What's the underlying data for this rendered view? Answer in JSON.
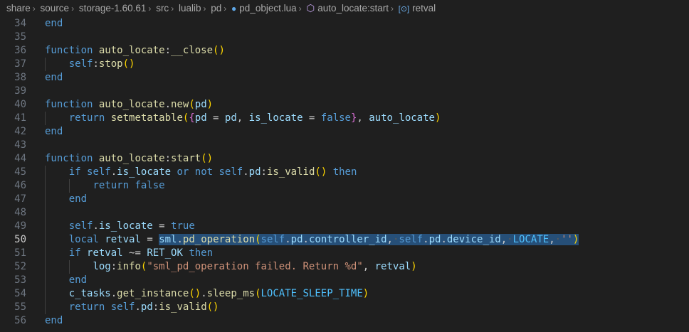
{
  "breadcrumb": {
    "items": [
      "share",
      "source",
      "storage-1.60.61",
      "src",
      "lualib",
      "pd"
    ],
    "file": "pd_object.lua",
    "symbol": "auto_locate:start",
    "variable": "retval"
  },
  "editor": {
    "current_line": 50,
    "line_numbers": [
      "34",
      "35",
      "36",
      "37",
      "38",
      "39",
      "40",
      "41",
      "42",
      "43",
      "44",
      "45",
      "46",
      "47",
      "48",
      "49",
      "50",
      "51",
      "52",
      "53",
      "54",
      "55",
      "56"
    ]
  }
}
